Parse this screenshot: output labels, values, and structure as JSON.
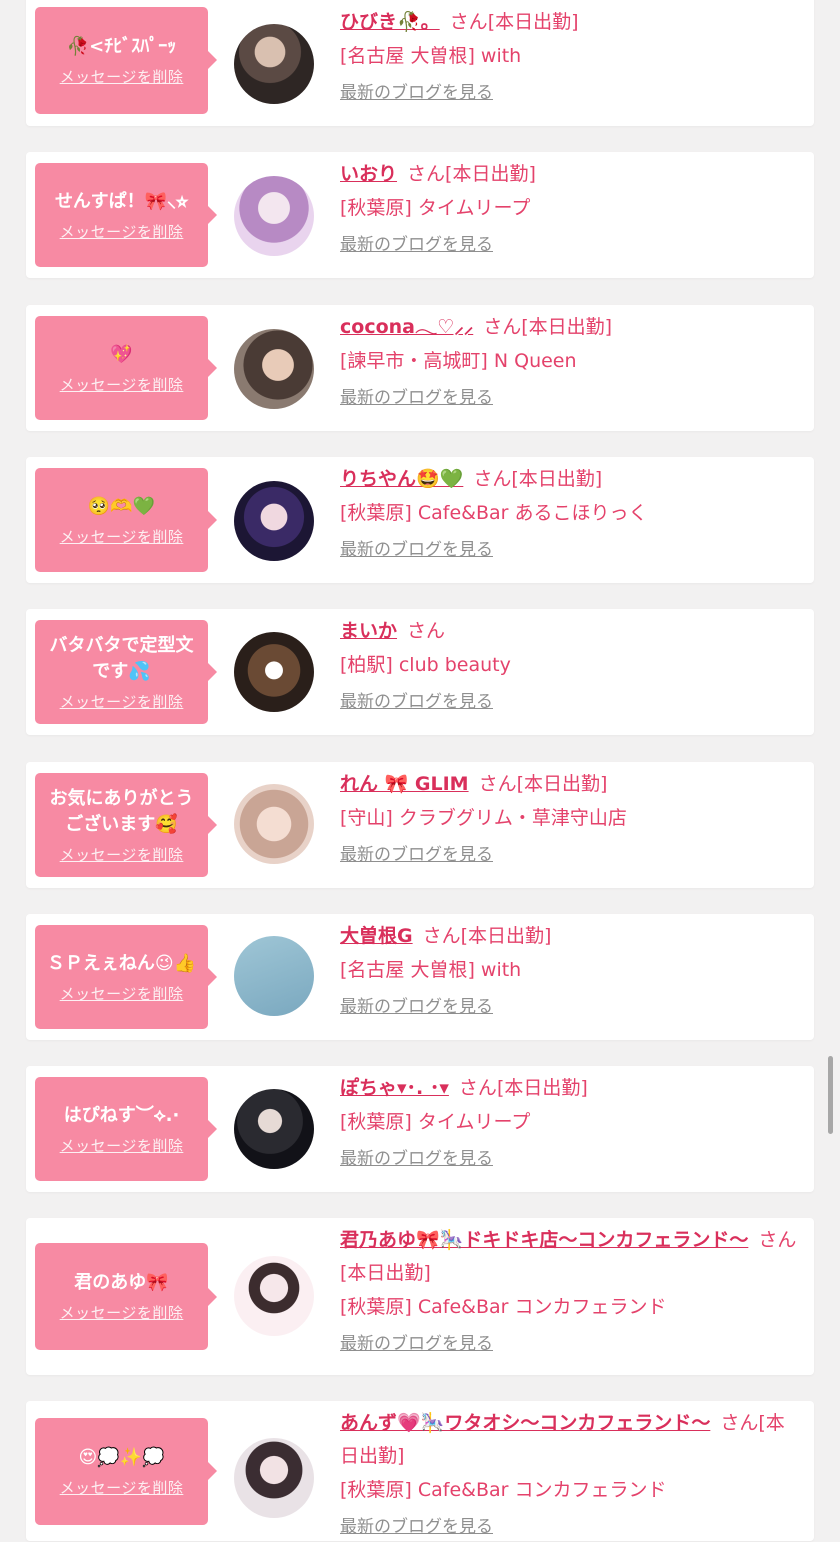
{
  "delete_label": "メッセージを削除",
  "blog_label": "最新のブログを見る",
  "san": "さん",
  "shift_badge": "[本日出勤]",
  "entries": [
    {
      "message": "🥀<ﾁﾋﾞｽﾊﾟｰｯ",
      "name": "ひびき🥀。",
      "shop": "[名古屋 大曽根] with",
      "on_shift": true
    },
    {
      "message": "せんすぱ！🎀⸜⭐︎",
      "name": "いおり",
      "shop": "[秋葉原] タイムリープ",
      "on_shift": true
    },
    {
      "message": "💖",
      "name": "cocona𓂃♡⸝⸝",
      "shop": "[諫早市・高城町] N Queen",
      "on_shift": true
    },
    {
      "message": "🥺🫶💚",
      "name": "りちやん🤩💚",
      "shop": "[秋葉原] Cafe&Bar あるこほりっく",
      "on_shift": true
    },
    {
      "message": "バタバタで定型文です💦",
      "name": "まいか",
      "shop": "[柏駅] club beauty",
      "on_shift": false
    },
    {
      "message": "お気にありがとうございます🥰",
      "name": "れん 🎀 GLIM",
      "shop": "[守山] クラブグリム・草津守山店",
      "on_shift": true
    },
    {
      "message": "ＳＰえぇねん😉👍",
      "name": "大曽根G",
      "shop": "[名古屋 大曽根] with",
      "on_shift": true
    },
    {
      "message": "はぴねす︶⟡.·",
      "name": "ぽちゃ▾･. ･▾",
      "shop": "[秋葉原] タイムリープ",
      "on_shift": true
    },
    {
      "message": "君のあゆ🎀",
      "name": "君乃あゆ🎀🎠ドキドキ店〜コンカフェランド〜",
      "shop": "[秋葉原] Cafe&Bar コンカフェランド",
      "on_shift": true
    },
    {
      "message": "😍💭✨💭",
      "name": "あんず💗🎠ワタオシ〜コンカフェランド〜",
      "shop": "[秋葉原] Cafe&Bar コンカフェランド",
      "on_shift": true
    }
  ]
}
